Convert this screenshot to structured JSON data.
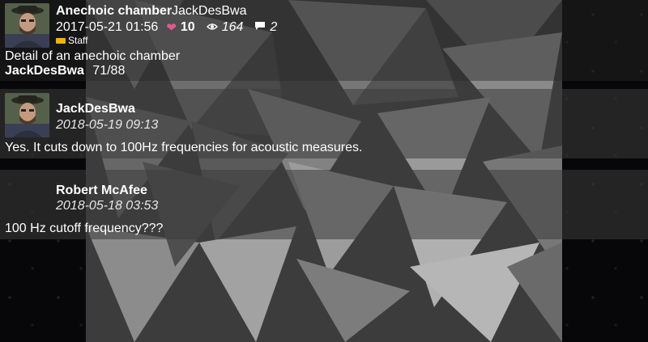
{
  "post": {
    "title": "Anechoic chamber",
    "author": "JackDesBwa",
    "datetime": "2017-05-21 01:56",
    "likes": "10",
    "views": "164",
    "comments": "2",
    "role": "Staff",
    "description": "Detail of an anechoic chamber",
    "credit_user": "JackDesBwa",
    "position": "71/88"
  },
  "replies": [
    {
      "author": "JackDesBwa",
      "datetime": "2018-05-19 09:13",
      "text": "Yes. It cuts down to 100Hz frequencies for acoustic measures."
    },
    {
      "author": "Robert McAfee",
      "datetime": "2018-05-18 03:53",
      "text": "100 Hz cutoff frequency???"
    }
  ],
  "icons": {
    "likes": "heart-icon",
    "views": "eye-icon",
    "comments": "speech-bubble-icon",
    "role": "staff-badge-icon"
  },
  "colors": {
    "heart": "#e8558e",
    "staff_badge": "#f0b400"
  }
}
